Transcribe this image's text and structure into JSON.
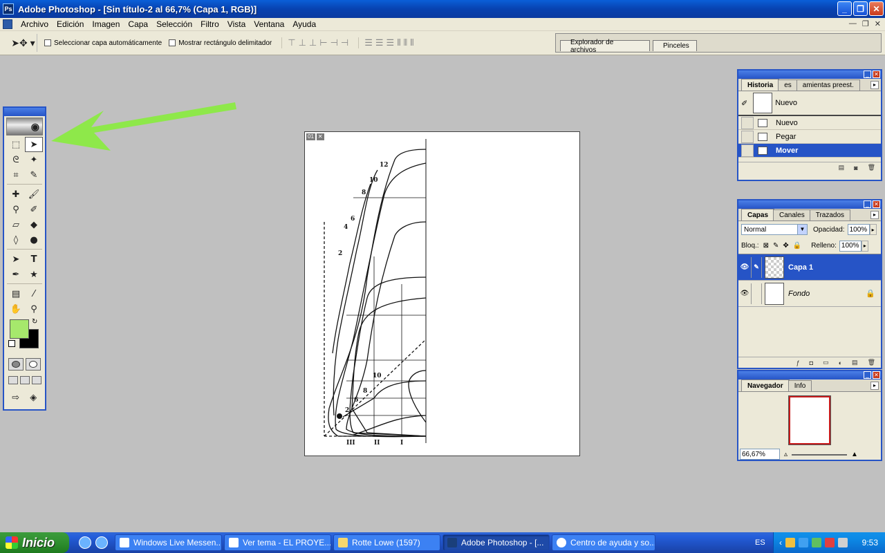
{
  "window": {
    "title": "Adobe Photoshop - [Sin título-2 al 66,7% (Capa 1, RGB)]",
    "app_icon_label": "Ps"
  },
  "menu": [
    "Archivo",
    "Edición",
    "Imagen",
    "Capa",
    "Selección",
    "Filtro",
    "Vista",
    "Ventana",
    "Ayuda"
  ],
  "options": {
    "auto_select_label": "Seleccionar capa automáticamente",
    "show_bounds_label": "Mostrar rectángulo delimitador",
    "well_tabs": [
      "Explorador de archivos",
      "Pinceles"
    ]
  },
  "document": {
    "badge_number": "01"
  },
  "history": {
    "tabs": [
      "Historia",
      "es",
      "amientas preest."
    ],
    "snapshot_label": "Nuevo",
    "steps": [
      "Nuevo",
      "Pegar",
      "Mover"
    ]
  },
  "layers": {
    "tabs": [
      "Capas",
      "Canales",
      "Trazados"
    ],
    "blend_mode": "Normal",
    "opacity_label": "Opacidad:",
    "opacity_value": "100%",
    "lock_label": "Bloq.:",
    "fill_label": "Relleno:",
    "fill_value": "100%",
    "items": [
      {
        "name": "Capa 1",
        "selected": true
      },
      {
        "name": "Fondo",
        "selected": false
      }
    ]
  },
  "navigator": {
    "tabs": [
      "Navegador",
      "Info"
    ],
    "zoom": "66,67%"
  },
  "colors": {
    "foreground": "#a6e86c",
    "background": "#000000",
    "selection": "#2654c6",
    "arrow": "#8ee84a"
  },
  "taskbar": {
    "start_label": "Inicio",
    "tasks": [
      "Windows Live Messen...",
      "Ver tema - EL PROYE...",
      "Rotte Lowe  (1597)",
      "Adobe Photoshop - [...",
      "Centro de ayuda y so..."
    ],
    "language": "ES",
    "clock": "9:53"
  }
}
